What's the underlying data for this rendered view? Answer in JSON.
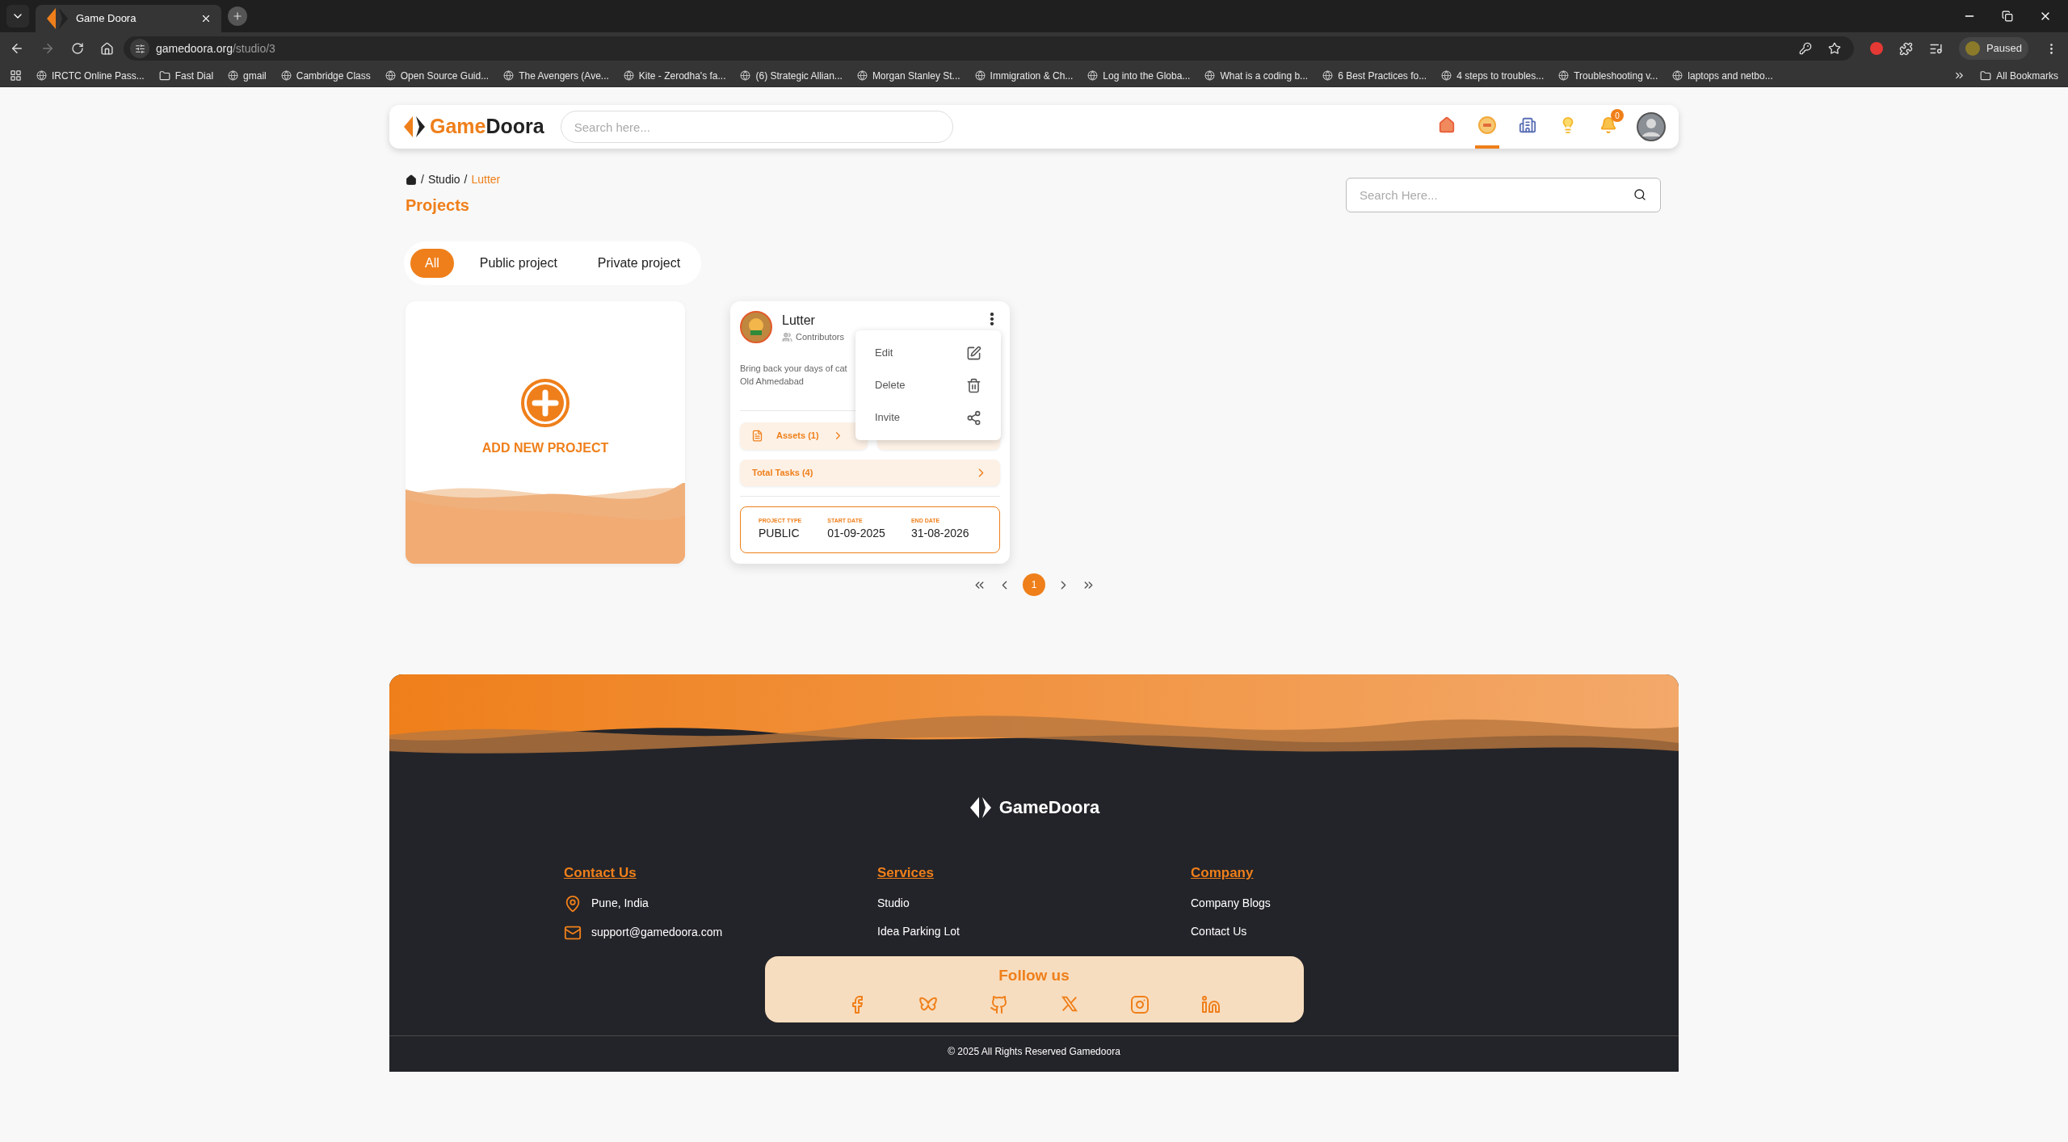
{
  "browser": {
    "tab_title": "Game Doora",
    "url_host": "gamedoora.org",
    "url_path": "/studio/3",
    "profile_label": "Paused",
    "bookmarks": [
      {
        "kind": "site",
        "label": "IRCTC Online Pass..."
      },
      {
        "kind": "folder",
        "label": "Fast Dial"
      },
      {
        "kind": "site",
        "label": "gmail"
      },
      {
        "kind": "site",
        "label": "Cambridge Class"
      },
      {
        "kind": "site",
        "label": "Open Source Guid..."
      },
      {
        "kind": "site",
        "label": "The Avengers (Ave..."
      },
      {
        "kind": "site",
        "label": "Kite - Zerodha's fa..."
      },
      {
        "kind": "site",
        "label": "(6) Strategic Allian..."
      },
      {
        "kind": "site",
        "label": "Morgan Stanley St..."
      },
      {
        "kind": "site",
        "label": "Immigration & Ch..."
      },
      {
        "kind": "site",
        "label": "Log into the Globa..."
      },
      {
        "kind": "site",
        "label": "What is a coding b..."
      },
      {
        "kind": "site",
        "label": "6 Best Practices fo..."
      },
      {
        "kind": "site",
        "label": "4 steps to troubles..."
      },
      {
        "kind": "site",
        "label": "Troubleshooting v..."
      },
      {
        "kind": "site",
        "label": "laptops and netbo..."
      }
    ],
    "all_bookmarks": "All Bookmarks"
  },
  "header": {
    "logo": {
      "part_1": "Game",
      "part_2": "Doora"
    },
    "search": {
      "placeholder": "Search here..."
    },
    "nav_items": [
      {
        "kind": "home",
        "selected": false
      },
      {
        "kind": "coin",
        "selected": true
      },
      {
        "kind": "building",
        "selected": false
      },
      {
        "kind": "idea",
        "selected": false
      },
      {
        "kind": "bell",
        "selected": false,
        "badge": "0"
      }
    ]
  },
  "breadcrumb": [
    {
      "kind": "home"
    },
    {
      "kind": "separator",
      "label": "/"
    },
    {
      "kind": "link",
      "label": "Studio"
    },
    {
      "kind": "separator",
      "label": "/"
    },
    {
      "kind": "current",
      "label": "Lutter"
    }
  ],
  "page_title": "Projects",
  "project_search": {
    "placeholder": "Search Here..."
  },
  "filter_tabs": [
    {
      "label": "All",
      "selected": true
    },
    {
      "label": "Public project",
      "selected": false
    },
    {
      "label": "Private project",
      "selected": false
    }
  ],
  "add_project": {
    "label": "ADD NEW PROJECT"
  },
  "project": {
    "name": "Lutter",
    "contributors": "Contributors",
    "description": [
      "Bring back your days of cat",
      "Old Ahmedabad"
    ],
    "assets": "Assets (1)",
    "tasks": "Total Tasks (4)",
    "details": [
      {
        "label": "PROJECT TYPE",
        "value": "PUBLIC"
      },
      {
        "label": "START DATE",
        "value": "01-09-2025"
      },
      {
        "label": "END DATE",
        "value": "31-08-2026"
      }
    ],
    "menu": [
      {
        "kind": "edit",
        "label": "Edit"
      },
      {
        "kind": "delete",
        "label": "Delete"
      },
      {
        "kind": "invite",
        "label": "Invite"
      }
    ]
  },
  "pagination": {
    "pages": [
      {
        "label": "1",
        "selected": true
      }
    ]
  },
  "footer": {
    "logo": "GameDoora",
    "columns": [
      {
        "title": "Contact Us",
        "items": [
          {
            "kind": "location",
            "label": "Pune, India"
          },
          {
            "kind": "mail",
            "label": "support@gamedoora.com"
          }
        ]
      },
      {
        "title": "Services",
        "items": [
          {
            "kind": "link",
            "label": "Studio"
          },
          {
            "kind": "link",
            "label": "Idea Parking Lot"
          }
        ]
      },
      {
        "title": "Company",
        "items": [
          {
            "kind": "link",
            "label": "Company Blogs"
          },
          {
            "kind": "link",
            "label": "Contact Us"
          }
        ]
      }
    ],
    "follow": {
      "title": "Follow us",
      "networks": [
        {
          "kind": "facebook"
        },
        {
          "kind": "butterfly"
        },
        {
          "kind": "github"
        },
        {
          "kind": "x"
        },
        {
          "kind": "instagram"
        },
        {
          "kind": "linkedin"
        }
      ]
    },
    "copyright": "© 2025 All Rights Reserved Gamedoora"
  }
}
